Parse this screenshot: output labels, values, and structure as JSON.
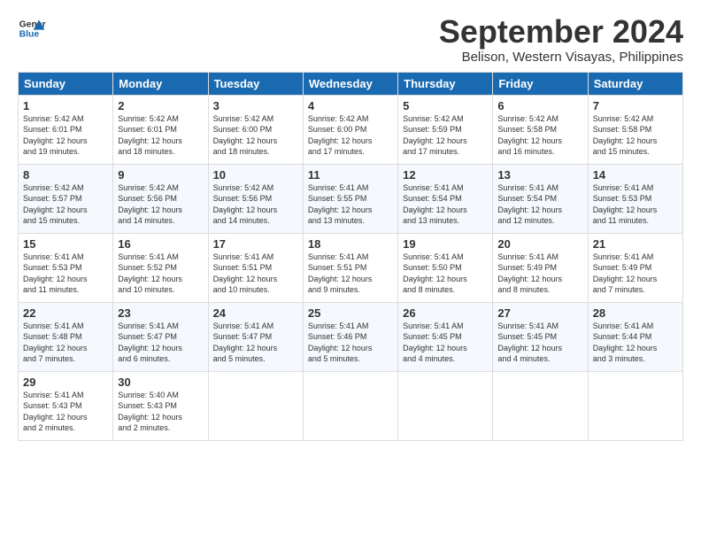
{
  "header": {
    "logo_line1": "General",
    "logo_line2": "Blue",
    "month": "September 2024",
    "location": "Belison, Western Visayas, Philippines"
  },
  "weekdays": [
    "Sunday",
    "Monday",
    "Tuesday",
    "Wednesday",
    "Thursday",
    "Friday",
    "Saturday"
  ],
  "weeks": [
    [
      {
        "day": "1",
        "info": "Sunrise: 5:42 AM\nSunset: 6:01 PM\nDaylight: 12 hours\nand 19 minutes."
      },
      {
        "day": "2",
        "info": "Sunrise: 5:42 AM\nSunset: 6:01 PM\nDaylight: 12 hours\nand 18 minutes."
      },
      {
        "day": "3",
        "info": "Sunrise: 5:42 AM\nSunset: 6:00 PM\nDaylight: 12 hours\nand 18 minutes."
      },
      {
        "day": "4",
        "info": "Sunrise: 5:42 AM\nSunset: 6:00 PM\nDaylight: 12 hours\nand 17 minutes."
      },
      {
        "day": "5",
        "info": "Sunrise: 5:42 AM\nSunset: 5:59 PM\nDaylight: 12 hours\nand 17 minutes."
      },
      {
        "day": "6",
        "info": "Sunrise: 5:42 AM\nSunset: 5:58 PM\nDaylight: 12 hours\nand 16 minutes."
      },
      {
        "day": "7",
        "info": "Sunrise: 5:42 AM\nSunset: 5:58 PM\nDaylight: 12 hours\nand 15 minutes."
      }
    ],
    [
      {
        "day": "8",
        "info": "Sunrise: 5:42 AM\nSunset: 5:57 PM\nDaylight: 12 hours\nand 15 minutes."
      },
      {
        "day": "9",
        "info": "Sunrise: 5:42 AM\nSunset: 5:56 PM\nDaylight: 12 hours\nand 14 minutes."
      },
      {
        "day": "10",
        "info": "Sunrise: 5:42 AM\nSunset: 5:56 PM\nDaylight: 12 hours\nand 14 minutes."
      },
      {
        "day": "11",
        "info": "Sunrise: 5:41 AM\nSunset: 5:55 PM\nDaylight: 12 hours\nand 13 minutes."
      },
      {
        "day": "12",
        "info": "Sunrise: 5:41 AM\nSunset: 5:54 PM\nDaylight: 12 hours\nand 13 minutes."
      },
      {
        "day": "13",
        "info": "Sunrise: 5:41 AM\nSunset: 5:54 PM\nDaylight: 12 hours\nand 12 minutes."
      },
      {
        "day": "14",
        "info": "Sunrise: 5:41 AM\nSunset: 5:53 PM\nDaylight: 12 hours\nand 11 minutes."
      }
    ],
    [
      {
        "day": "15",
        "info": "Sunrise: 5:41 AM\nSunset: 5:53 PM\nDaylight: 12 hours\nand 11 minutes."
      },
      {
        "day": "16",
        "info": "Sunrise: 5:41 AM\nSunset: 5:52 PM\nDaylight: 12 hours\nand 10 minutes."
      },
      {
        "day": "17",
        "info": "Sunrise: 5:41 AM\nSunset: 5:51 PM\nDaylight: 12 hours\nand 10 minutes."
      },
      {
        "day": "18",
        "info": "Sunrise: 5:41 AM\nSunset: 5:51 PM\nDaylight: 12 hours\nand 9 minutes."
      },
      {
        "day": "19",
        "info": "Sunrise: 5:41 AM\nSunset: 5:50 PM\nDaylight: 12 hours\nand 8 minutes."
      },
      {
        "day": "20",
        "info": "Sunrise: 5:41 AM\nSunset: 5:49 PM\nDaylight: 12 hours\nand 8 minutes."
      },
      {
        "day": "21",
        "info": "Sunrise: 5:41 AM\nSunset: 5:49 PM\nDaylight: 12 hours\nand 7 minutes."
      }
    ],
    [
      {
        "day": "22",
        "info": "Sunrise: 5:41 AM\nSunset: 5:48 PM\nDaylight: 12 hours\nand 7 minutes."
      },
      {
        "day": "23",
        "info": "Sunrise: 5:41 AM\nSunset: 5:47 PM\nDaylight: 12 hours\nand 6 minutes."
      },
      {
        "day": "24",
        "info": "Sunrise: 5:41 AM\nSunset: 5:47 PM\nDaylight: 12 hours\nand 5 minutes."
      },
      {
        "day": "25",
        "info": "Sunrise: 5:41 AM\nSunset: 5:46 PM\nDaylight: 12 hours\nand 5 minutes."
      },
      {
        "day": "26",
        "info": "Sunrise: 5:41 AM\nSunset: 5:45 PM\nDaylight: 12 hours\nand 4 minutes."
      },
      {
        "day": "27",
        "info": "Sunrise: 5:41 AM\nSunset: 5:45 PM\nDaylight: 12 hours\nand 4 minutes."
      },
      {
        "day": "28",
        "info": "Sunrise: 5:41 AM\nSunset: 5:44 PM\nDaylight: 12 hours\nand 3 minutes."
      }
    ],
    [
      {
        "day": "29",
        "info": "Sunrise: 5:41 AM\nSunset: 5:43 PM\nDaylight: 12 hours\nand 2 minutes."
      },
      {
        "day": "30",
        "info": "Sunrise: 5:40 AM\nSunset: 5:43 PM\nDaylight: 12 hours\nand 2 minutes."
      },
      {
        "day": "",
        "info": ""
      },
      {
        "day": "",
        "info": ""
      },
      {
        "day": "",
        "info": ""
      },
      {
        "day": "",
        "info": ""
      },
      {
        "day": "",
        "info": ""
      }
    ]
  ]
}
